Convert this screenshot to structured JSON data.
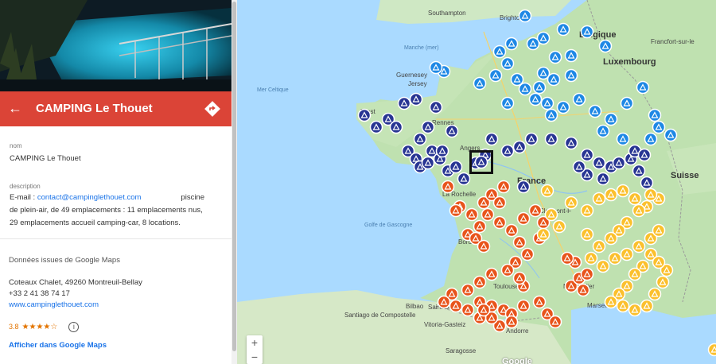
{
  "place": {
    "title": "CAMPING Le Thouet",
    "name_label": "nom",
    "name_value": "CAMPING Le Thouet",
    "description_label": "description",
    "description_prefix": "E-mail : ",
    "email": "contact@campinglethouet.com",
    "description_rest_1": "piscine",
    "description_rest_2": "de plein-air, de 49 emplacements : 11 emplacements nus,",
    "description_rest_3": "29 emplacements accueil camping-car, 8 locations."
  },
  "google_maps": {
    "heading": "Données issues de Google Maps",
    "address": "Coteaux Chalet, 49260 Montreuil-Bellay",
    "phone": "+33 2 41 38 74 17",
    "website": "www.campinglethouet.com",
    "rating": "3.8",
    "stars": "★★★★☆",
    "open_link": "Afficher dans Google Maps"
  },
  "map": {
    "labels": [
      {
        "text": "Southampton",
        "cls": "map-label"
      },
      {
        "text": "Brighton",
        "cls": "map-label"
      },
      {
        "text": "Manche (mer)",
        "cls": "map-label sea"
      },
      {
        "text": "Belgique",
        "cls": "map-label country"
      },
      {
        "text": "Luxembourg",
        "cls": "map-label country"
      },
      {
        "text": "Guernesey",
        "cls": "map-label"
      },
      {
        "text": "Jersey",
        "cls": "map-label"
      },
      {
        "text": "Mer Celtique",
        "cls": "map-label sea"
      },
      {
        "text": "Brest",
        "cls": "map-label"
      },
      {
        "text": "Rennes",
        "cls": "map-label"
      },
      {
        "text": "Angers",
        "cls": "map-label"
      },
      {
        "text": "France",
        "cls": "map-label country"
      },
      {
        "text": "Clermont-F",
        "cls": "map-label"
      },
      {
        "text": "La Rochelle",
        "cls": "map-label"
      },
      {
        "text": "Golfe de Gascogne",
        "cls": "map-label sea"
      },
      {
        "text": "Bordeaux",
        "cls": "map-label"
      },
      {
        "text": "Toulouse",
        "cls": "map-label"
      },
      {
        "text": "Bilbao",
        "cls": "map-label"
      },
      {
        "text": "Saint-Sebastien",
        "cls": "map-label"
      },
      {
        "text": "Vitoria-Gasteiz",
        "cls": "map-label"
      },
      {
        "text": "Santiago de Compostelle",
        "cls": "map-label"
      },
      {
        "text": "Saragosse",
        "cls": "map-label"
      },
      {
        "text": "Andorre",
        "cls": "map-label"
      },
      {
        "text": "Montpellier",
        "cls": "map-label"
      },
      {
        "text": "Marseille",
        "cls": "map-label"
      },
      {
        "text": "Suisse",
        "cls": "map-label country"
      },
      {
        "text": "Francfort-sur-le",
        "cls": "map-label"
      }
    ],
    "zoom_in": "+",
    "zoom_out": "−",
    "logo": "Google"
  }
}
